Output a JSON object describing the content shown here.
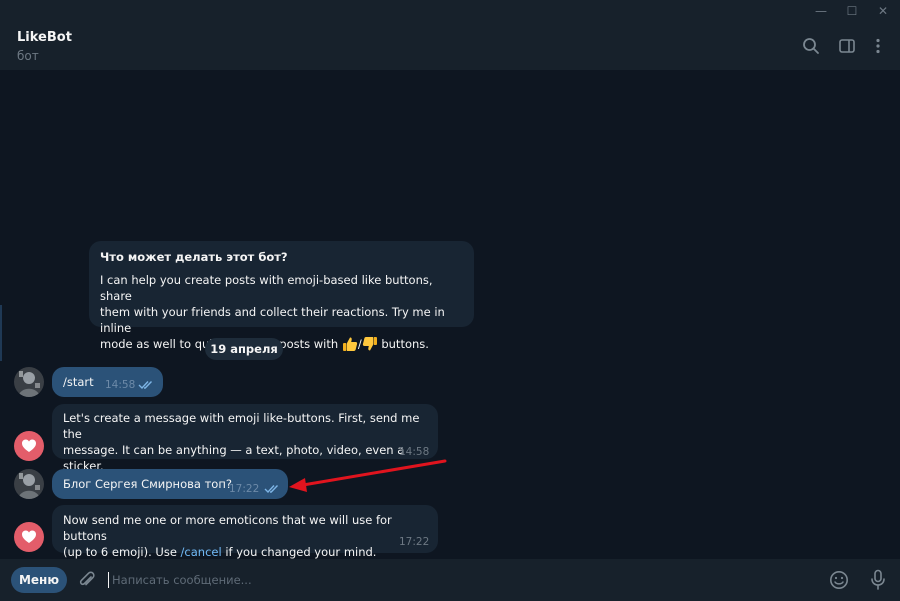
{
  "window": {
    "controls": {
      "minimize": "—",
      "maximize": "☐",
      "close": "✕"
    }
  },
  "header": {
    "title": "LikeBot",
    "subtitle": "бот",
    "icons": [
      "search-icon",
      "sidebar-toggle-icon",
      "more-vertical-icon"
    ]
  },
  "bot_info": {
    "title": "Что может делать этот бот?",
    "body_line1": "I can help you create posts with emoji-based like buttons, share",
    "body_line2": "them with your friends and collect their reactions. Try me in inline",
    "body_line3_pre": "mode as well to quickly create posts with ",
    "body_line3_sep": "/",
    "body_line3_post": " buttons."
  },
  "date_divider": "19 апреля",
  "messages": [
    {
      "id": "m1",
      "side": "out",
      "text": "/start",
      "time": "14:58",
      "status": "read"
    },
    {
      "id": "m2",
      "side": "in",
      "line1": "Let's create a message with emoji like-buttons. First, send me the",
      "line2": "message. It can be anything — a text, photo, video, even a sticker.",
      "time": "14:58"
    },
    {
      "id": "m3",
      "side": "out",
      "text": "Блог Сергея Смирнова топ?",
      "time": "17:22",
      "status": "read"
    },
    {
      "id": "m4",
      "side": "in",
      "line1": "Now send me one or more emoticons that we will use for buttons",
      "line2_pre": "(up to 6 emoji). Use ",
      "line2_link": "/cancel",
      "line2_post": " if you changed your mind.",
      "time": "17:22"
    }
  ],
  "composer": {
    "menu_label": "Меню",
    "placeholder": "Написать сообщение..."
  },
  "colors": {
    "background": "#0e1621",
    "header": "#17212b",
    "incoming_bubble": "#182533",
    "outgoing_bubble": "#2b5278",
    "link": "#71baf7",
    "annotation_arrow": "#e0141e",
    "bot_avatar": "#e35d6a"
  }
}
